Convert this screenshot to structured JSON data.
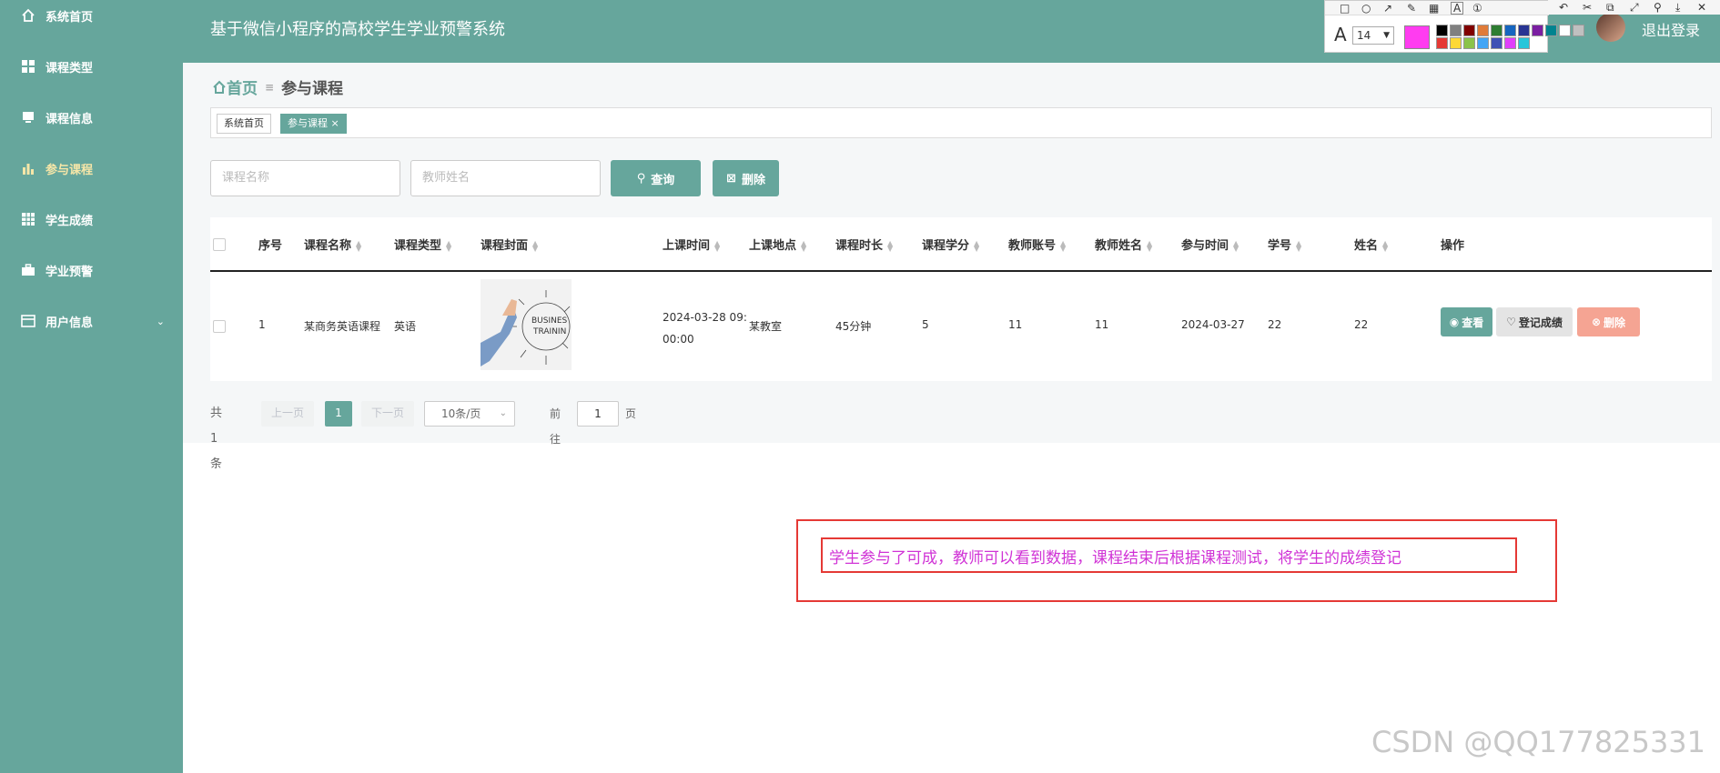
{
  "sidebar": {
    "items": [
      {
        "label": "系统首页",
        "icon": "home-icon"
      },
      {
        "label": "课程类型",
        "icon": "grid-icon"
      },
      {
        "label": "课程信息",
        "icon": "monitor-icon"
      },
      {
        "label": "参与课程",
        "icon": "bar-chart-icon",
        "active": true
      },
      {
        "label": "学生成绩",
        "icon": "table-icon"
      },
      {
        "label": "学业预警",
        "icon": "briefcase-icon"
      },
      {
        "label": "用户信息",
        "icon": "card-icon",
        "expandable": true
      }
    ]
  },
  "header": {
    "title": "基于微信小程序的高校学生学业预警系统",
    "logout": "退出登录"
  },
  "annotation_toolbar": {
    "font_size": "14",
    "current_color": "#ff3cf0",
    "palette": [
      "#000000",
      "#808080",
      "#800000",
      "#e07b39",
      "#2e7d32",
      "#1565c0",
      "#283593",
      "#7b1fa2",
      "#00838f",
      "#ffffff",
      "#c0c0c0",
      "#e53935",
      "#fdd835",
      "#8bc34a",
      "#42a5f5",
      "#3f51b5",
      "#e040fb",
      "#26c6da"
    ]
  },
  "breadcrumb": {
    "home": "首页",
    "current": "参与课程"
  },
  "tabs": [
    {
      "label": "系统首页"
    },
    {
      "label": "参与课程",
      "closable": true
    }
  ],
  "search": {
    "course_name_placeholder": "课程名称",
    "teacher_name_placeholder": "教师姓名",
    "query_label": "查询",
    "delete_label": "删除"
  },
  "table": {
    "headers": [
      "序号",
      "课程名称",
      "课程类型",
      "课程封面",
      "上课时间",
      "上课地点",
      "课程时长",
      "课程学分",
      "教师账号",
      "教师姓名",
      "参与时间",
      "学号",
      "姓名",
      "操作"
    ],
    "rows": [
      {
        "no": "1",
        "course_name": "某商务英语课程",
        "course_type": "英语",
        "cover_text": "BUSINESS TRAINING",
        "time_line1": "2024-03-28 09:",
        "time_line2": "00:00",
        "place": "某教室",
        "duration": "45分钟",
        "credit": "5",
        "teacher_account": "11",
        "teacher_name": "11",
        "join_time": "2024-03-27",
        "student_no": "22",
        "name": "22"
      }
    ],
    "actions": {
      "view": "查看",
      "grade": "登记成绩",
      "delete": "删除"
    }
  },
  "pager": {
    "total": "共 1 条",
    "prev": "上一页",
    "current": "1",
    "next": "下一页",
    "size": "10条/页",
    "goto": "前往",
    "goto_value": "1",
    "page_unit": "页"
  },
  "annotation": {
    "text": "学生参与了可成，教师可以看到数据，课程结束后根据课程测试，将学生的成绩登记"
  },
  "watermark": "CSDN @QQ177825331",
  "colors": {
    "brand": "#66a69c",
    "delete_btn": "#f5a493",
    "annotation": "#d033d6",
    "annot_box": "#e53935"
  }
}
